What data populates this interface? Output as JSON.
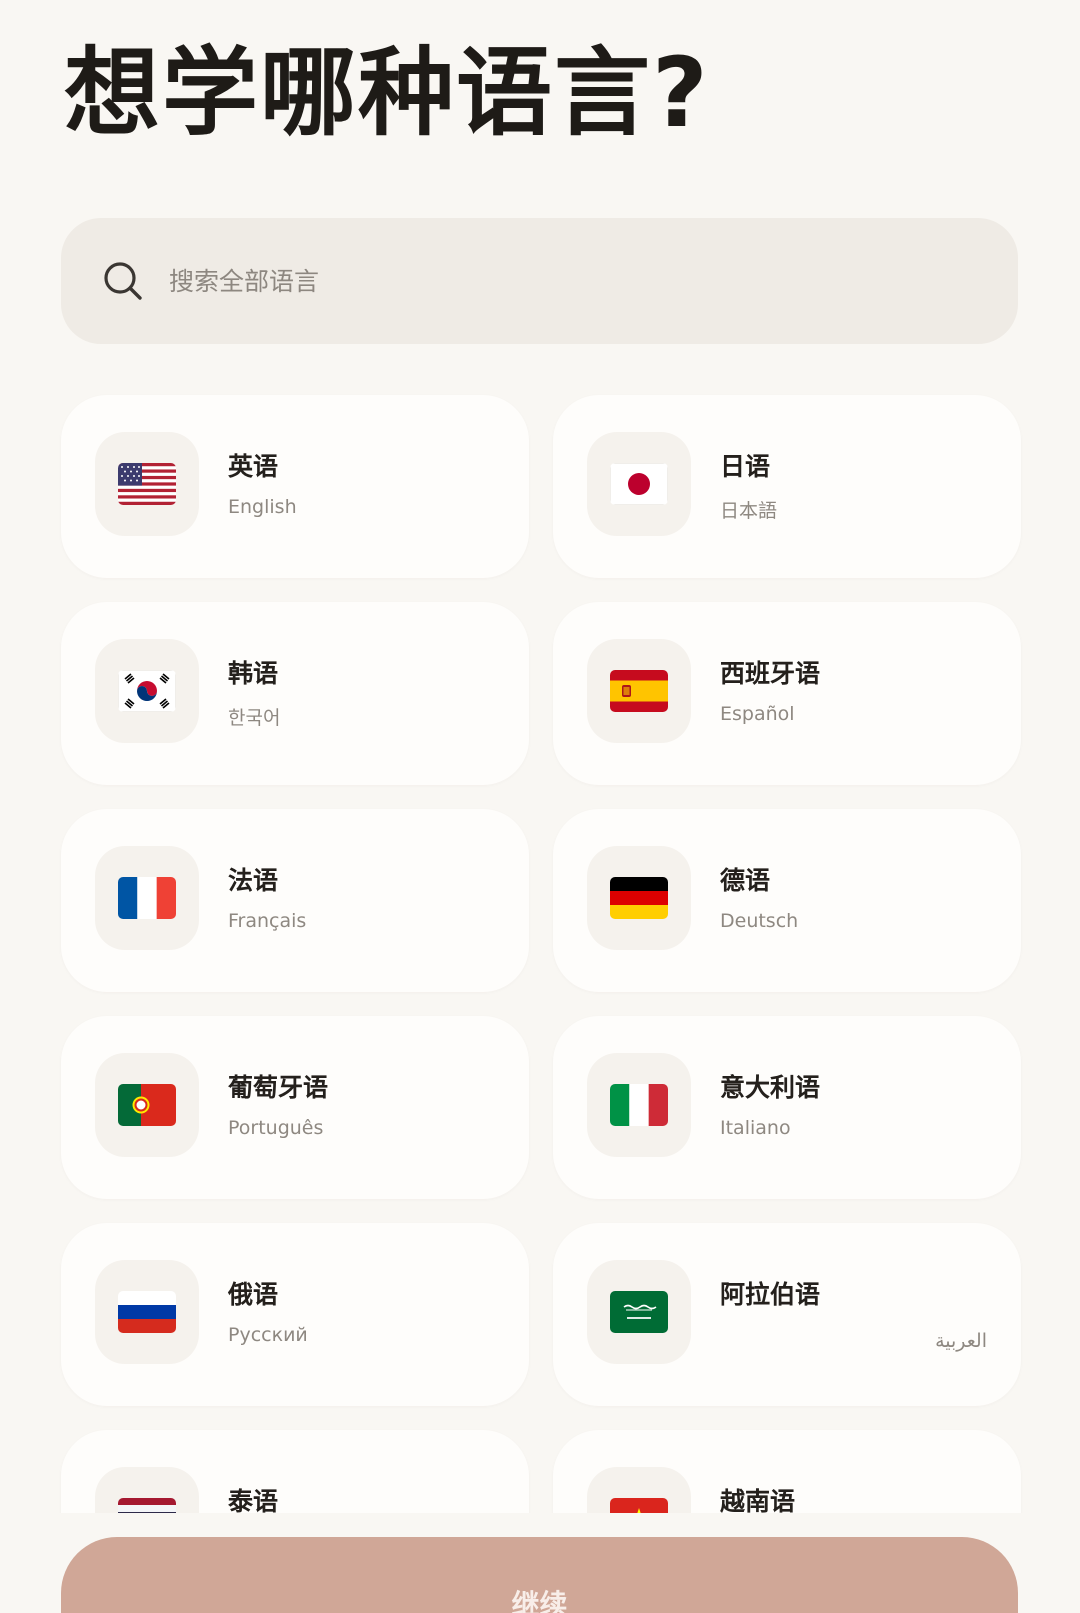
{
  "header": {
    "title": "想学哪种语言?"
  },
  "search": {
    "placeholder": "搜索全部语言",
    "icon": "search-icon"
  },
  "languages": [
    {
      "name": "英语",
      "native": "English",
      "flag": "us-flag-icon"
    },
    {
      "name": "日语",
      "native": "日本語",
      "flag": "japan-flag-icon"
    },
    {
      "name": "韩语",
      "native": "한국어",
      "flag": "korea-flag-icon"
    },
    {
      "name": "西班牙语",
      "native": "Español",
      "flag": "spain-flag-icon"
    },
    {
      "name": "法语",
      "native": "Français",
      "flag": "france-flag-icon"
    },
    {
      "name": "德语",
      "native": "Deutsch",
      "flag": "germany-flag-icon"
    },
    {
      "name": "葡萄牙语",
      "native": "Português",
      "flag": "portugal-flag-icon"
    },
    {
      "name": "意大利语",
      "native": "Italiano",
      "flag": "italy-flag-icon"
    },
    {
      "name": "俄语",
      "native": "Русский",
      "flag": "russia-flag-icon"
    },
    {
      "name": "阿拉伯语",
      "native": "العربية",
      "flag": "saudi-flag-icon"
    },
    {
      "name": "泰语",
      "native": "",
      "flag": "thailand-flag-icon"
    },
    {
      "name": "越南语",
      "native": "",
      "flag": "vietnam-flag-icon"
    }
  ],
  "footer": {
    "continue_label": "继续"
  },
  "colors": {
    "background": "#f9f7f3",
    "card": "#fefdfb",
    "search_bg": "#efebe5",
    "button": "#d0a797",
    "title_text": "#1e1b17",
    "muted_text": "#8e8881"
  }
}
